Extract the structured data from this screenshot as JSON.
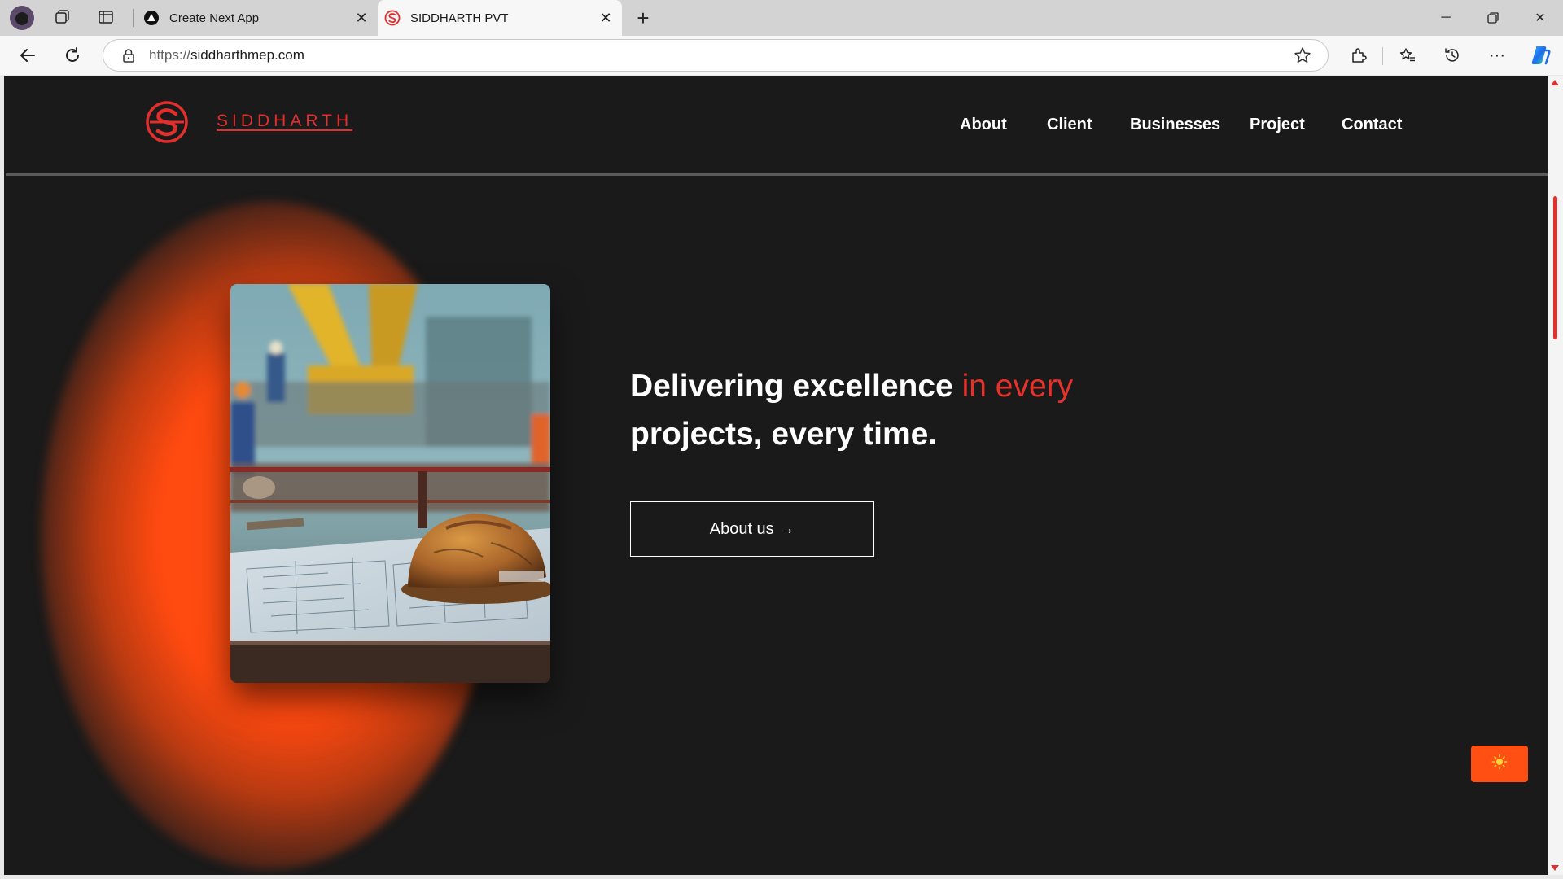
{
  "browser": {
    "tabs": [
      {
        "title": "Create Next App",
        "favicon": "triangle-icon"
      },
      {
        "title": "SIDDHARTH PVT",
        "favicon": "siddharth-logo-icon",
        "active": true
      }
    ],
    "address": {
      "protocol": "https://",
      "host": "siddharthmep.com"
    }
  },
  "site": {
    "brand": "SIDDHARTH",
    "nav": [
      "About",
      "Client",
      "Businesses",
      "Project",
      "Contact"
    ],
    "hero": {
      "title_part1": "Delivering excellence ",
      "title_accent": "in every",
      "title_part2": "projects, every time.",
      "cta": "About us →"
    },
    "theme_toggle_icon": "sun-icon"
  },
  "colors": {
    "accent": "#e5332c",
    "glow": "#ff4d12",
    "background": "#1a1a1a",
    "toggle": "#ff4f12"
  }
}
